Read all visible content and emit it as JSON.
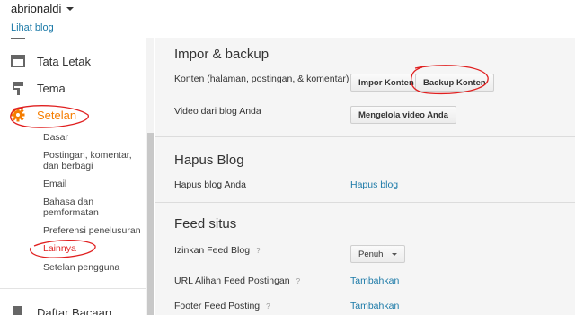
{
  "header": {
    "blog_name": "abrionaldi",
    "view_blog": "Lihat blog"
  },
  "sidebar": {
    "items": [
      {
        "label": "Tata Letak",
        "icon": "layout-icon"
      },
      {
        "label": "Tema",
        "icon": "paint-roller-icon"
      },
      {
        "label": "Setelan",
        "icon": "gear-icon",
        "active": true
      },
      {
        "label": "Daftar Bacaan",
        "icon": "bookmark-icon"
      }
    ],
    "subitems": [
      "Dasar",
      "Postingan, komentar, dan berbagi",
      "Email",
      "Bahasa dan pemformatan",
      "Preferensi penelusuran",
      "Lainnya",
      "Setelan pengguna"
    ]
  },
  "main": {
    "import_backup": {
      "title": "Impor & backup",
      "content_label": "Konten (halaman, postingan, & komentar)",
      "import_button": "Impor Konten",
      "backup_button": "Backup Konten",
      "video_label": "Video dari blog Anda",
      "video_button": "Mengelola video Anda"
    },
    "delete_blog": {
      "title": "Hapus Blog",
      "label": "Hapus blog Anda",
      "link": "Hapus blog"
    },
    "feed": {
      "title": "Feed situs",
      "allow_label": "Izinkan Feed Blog",
      "allow_value": "Penuh",
      "redirect_label": "URL Alihan Feed Postingan",
      "redirect_link": "Tambahkan",
      "footer_label": "Footer Feed Posting",
      "footer_link": "Tambahkan",
      "help_glyph": "?"
    }
  },
  "colors": {
    "accent_orange": "#f57d00",
    "link_blue": "#1c7aa8",
    "annotation_red": "#e02020"
  }
}
